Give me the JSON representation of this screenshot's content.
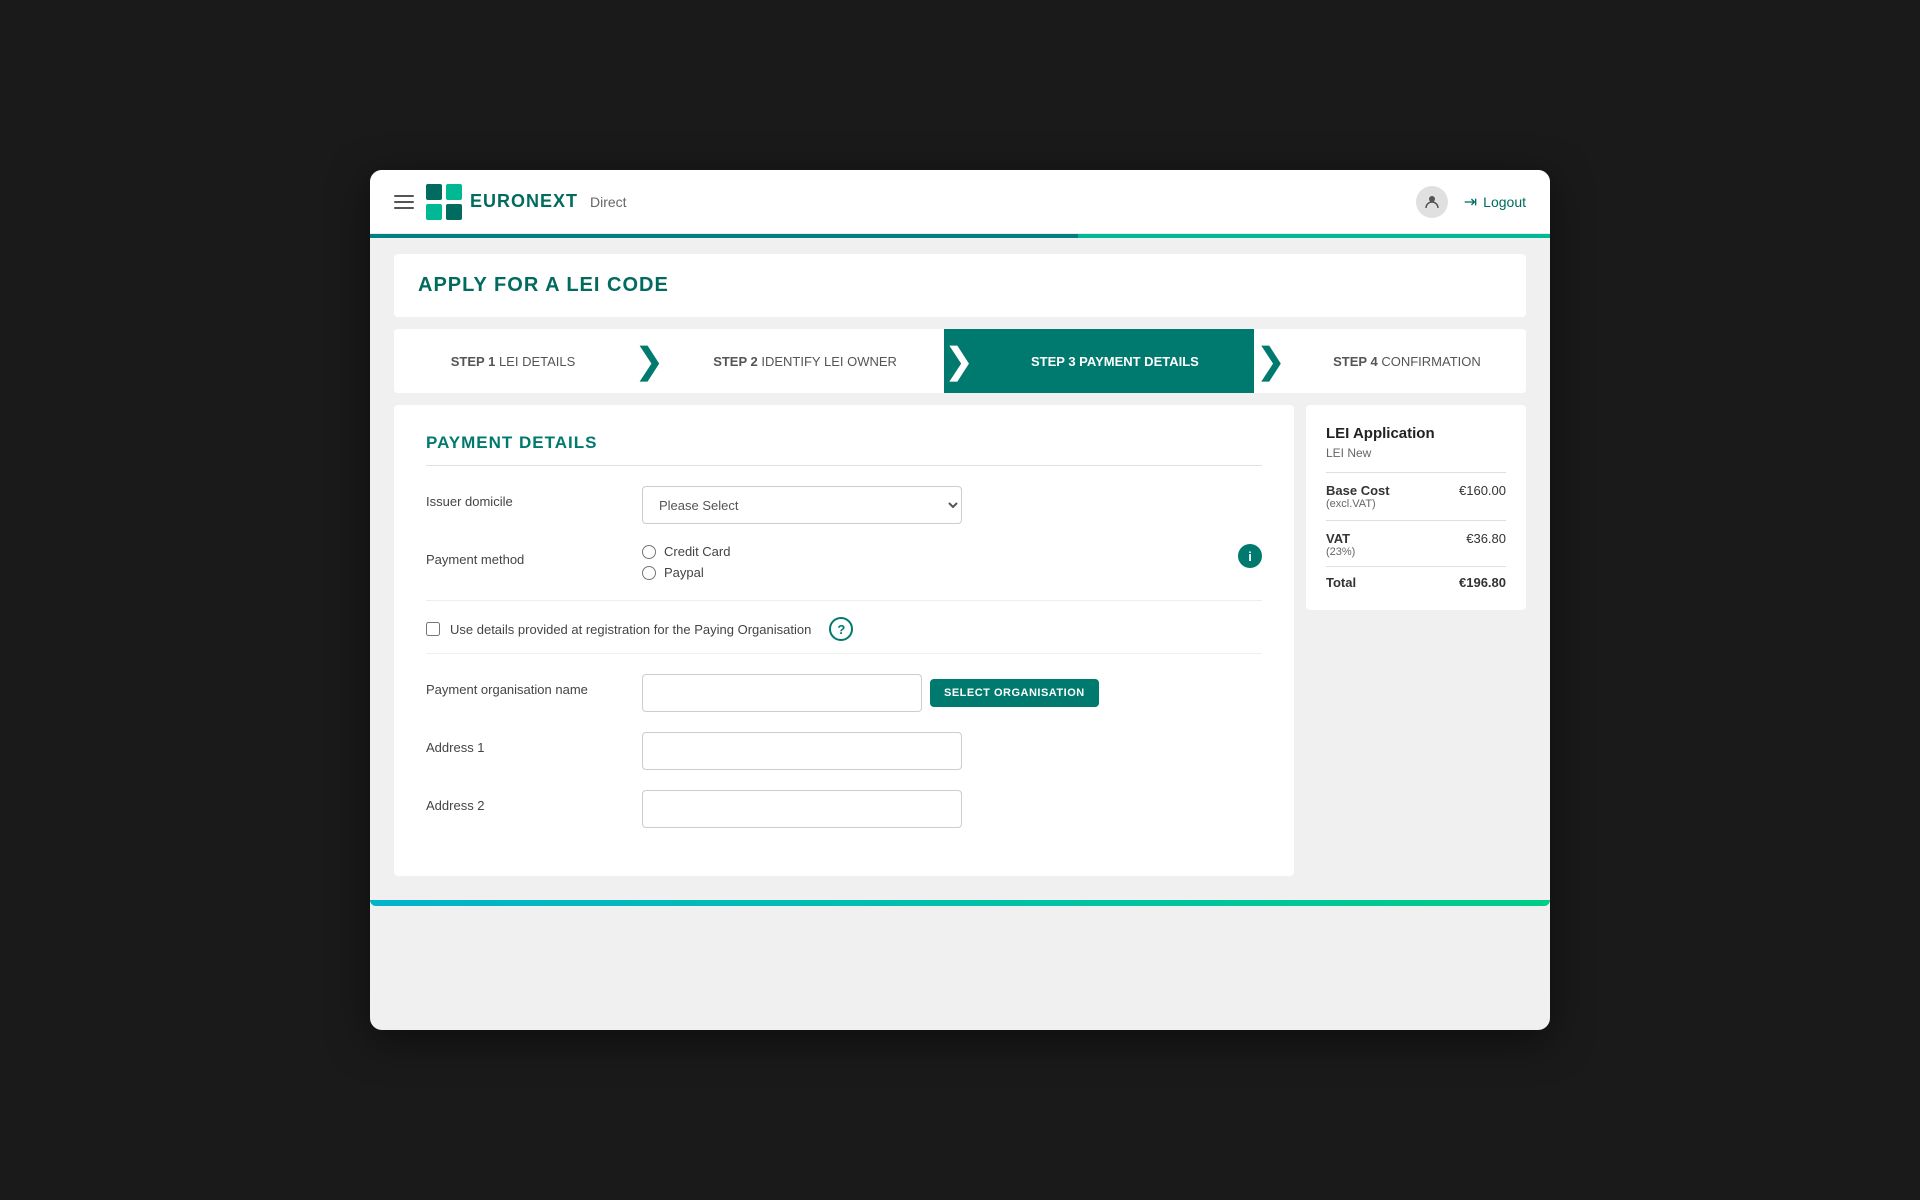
{
  "nav": {
    "brand": "EURONEXT",
    "direct": "Direct",
    "logout_label": "Logout"
  },
  "page": {
    "title": "APPLY FOR A LEI CODE"
  },
  "steps": [
    {
      "id": "step1",
      "num": "STEP 1",
      "label": "LEI DETAILS",
      "active": false
    },
    {
      "id": "step2",
      "num": "STEP 2",
      "label": "IDENTIFY LEI OWNER",
      "active": false
    },
    {
      "id": "step3",
      "num": "STEP 3",
      "label": "PAYMENT DETAILS",
      "active": true
    },
    {
      "id": "step4",
      "num": "STEP 4",
      "label": "CONFIRMATION",
      "active": false
    }
  ],
  "form": {
    "section_title": "PAYMENT DETAILS",
    "issuer_domicile_label": "Issuer domicile",
    "issuer_domicile_placeholder": "Please Select",
    "payment_method_label": "Payment method",
    "payment_method_options": [
      {
        "value": "credit_card",
        "label": "Credit Card"
      },
      {
        "value": "paypal",
        "label": "Paypal"
      }
    ],
    "checkbox_label": "Use details provided at registration for the Paying Organisation",
    "org_name_label": "Payment organisation name",
    "org_name_placeholder": "",
    "select_org_btn": "SELECT ORGANISATION",
    "address1_label": "Address 1",
    "address1_placeholder": "",
    "address2_label": "Address 2",
    "address2_placeholder": ""
  },
  "sidebar": {
    "app_title": "LEI Application",
    "app_subtitle": "LEI New",
    "base_cost_label": "Base Cost",
    "base_cost_sublabel": "(excl.VAT)",
    "base_cost_value": "€160.00",
    "vat_label": "VAT",
    "vat_sublabel": "(23%)",
    "vat_value": "€36.80",
    "total_label": "Total",
    "total_value": "€196.80"
  }
}
